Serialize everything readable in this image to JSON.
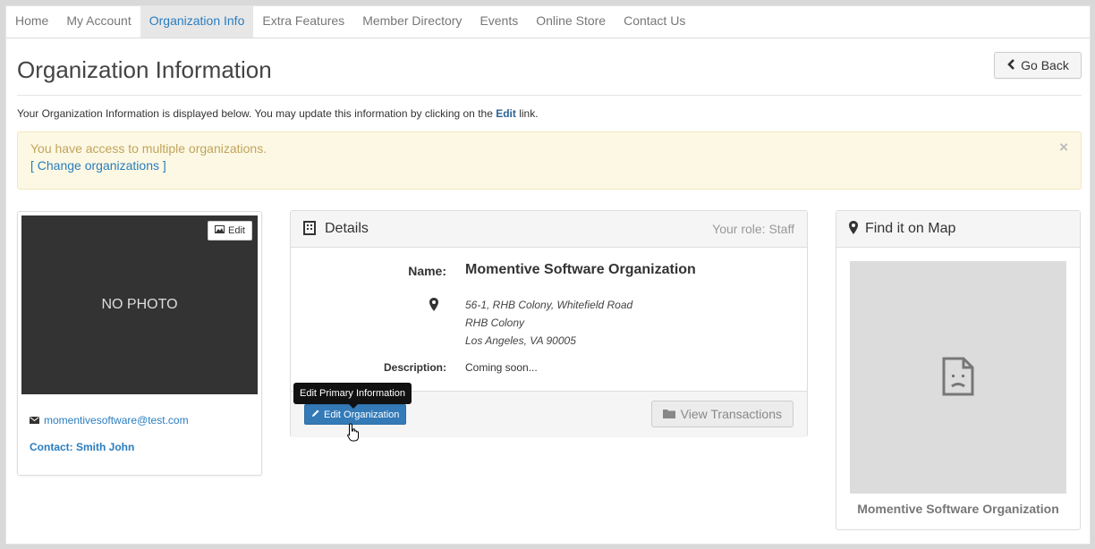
{
  "nav": {
    "items": [
      {
        "label": "Home"
      },
      {
        "label": "My Account"
      },
      {
        "label": "Organization Info"
      },
      {
        "label": "Extra Features"
      },
      {
        "label": "Member Directory"
      },
      {
        "label": "Events"
      },
      {
        "label": "Online Store"
      },
      {
        "label": "Contact Us"
      }
    ],
    "active": "Organization Info"
  },
  "page": {
    "title": "Organization Information",
    "go_back_label": "Go Back",
    "intro_before": "Your Organization Information is displayed below. You may update this information by clicking on the ",
    "intro_link": "Edit",
    "intro_after": " link."
  },
  "alert": {
    "message": "You have access to multiple organizations.",
    "link": "[ Change organizations ]",
    "close": "×"
  },
  "photo_card": {
    "placeholder": "NO PHOTO",
    "edit_label": "Edit",
    "email": "momentivesoftware@test.com",
    "contact": "Contact: Smith John"
  },
  "details": {
    "title": "Details",
    "role": "Your role: Staff",
    "name_label": "Name:",
    "name_value": "Momentive Software Organization",
    "address_lines": [
      "56-1, RHB Colony, Whitefield Road",
      "RHB Colony",
      "Los Angeles, VA 90005"
    ],
    "description_label": "Description:",
    "description_value": "Coming soon...",
    "edit_button": "Edit Organization",
    "view_transactions": "View Transactions",
    "tooltip": "Edit Primary Information"
  },
  "map": {
    "title": "Find it on Map",
    "caption": "Momentive Software Organization"
  },
  "colors": {
    "link": "#2a7dbf",
    "primary_button": "#337ab7",
    "alert_bg": "#fcf8e3",
    "alert_text": "#c1a45d"
  }
}
